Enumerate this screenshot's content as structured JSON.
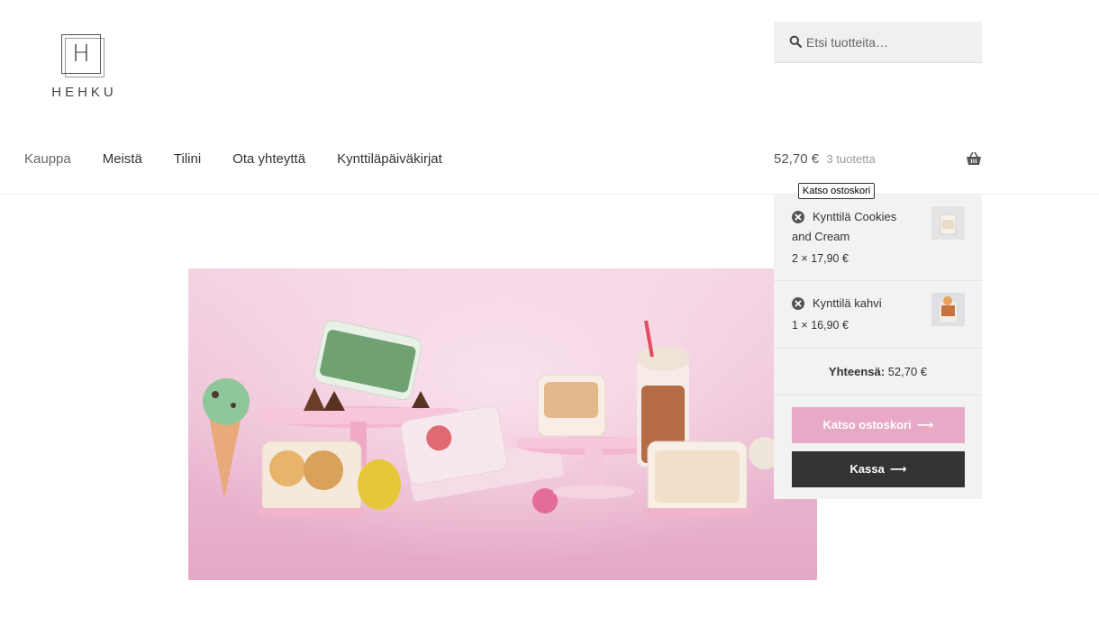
{
  "brand": {
    "logo_letter": "H",
    "name": "HEHKU"
  },
  "search": {
    "placeholder": "Etsi tuotteita…"
  },
  "nav": [
    "Kauppa",
    "Meistä",
    "Tilini",
    "Ota yhteyttä",
    "Kynttiläpäiväkirjat"
  ],
  "cart": {
    "amount": "52,70 €",
    "count": "3 tuotetta",
    "tooltip": "Katso ostoskori",
    "items": [
      {
        "name_line1": "Kynttilä Cookies",
        "name_line2": "and Cream",
        "qty": "2 × 17,90 €"
      },
      {
        "name_line1": "Kynttilä kahvi",
        "name_line2": "",
        "qty": "1 × 16,90 €"
      }
    ],
    "total_label": "Yhteensä:",
    "total_value": "52,70 €",
    "view_cart_label": "Katso ostoskori",
    "checkout_label": "Kassa"
  },
  "colors": {
    "accent_pink": "#e7a9c6",
    "dark_button": "#333333",
    "hero_bg": "#f2c7dc"
  }
}
